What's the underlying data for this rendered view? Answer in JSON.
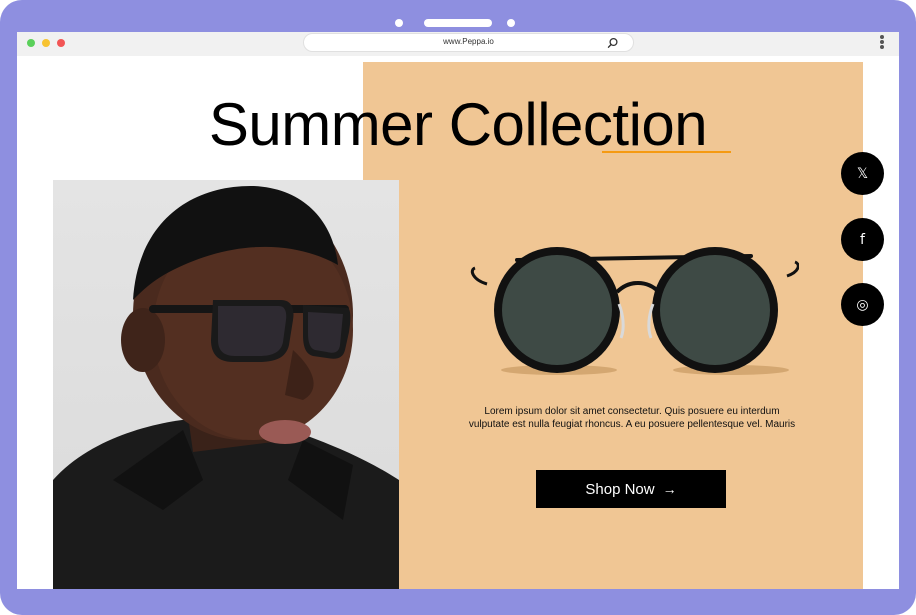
{
  "browser": {
    "url": "www.Peppa.io",
    "traffic_colors": [
      "#5ad05a",
      "#f7c331",
      "#f25555"
    ]
  },
  "hero": {
    "title": "Summer Collection",
    "accent_color": "#f59a12",
    "panel_color": "#f0c694"
  },
  "product": {
    "description_line1": "Lorem ipsum dolor sit amet consectetur. Quis posuere eu interdum",
    "description_line2": "vulputate est nulla feugiat rhoncus. A eu posuere pellentesque vel. Mauris",
    "cta_label": "Shop Now",
    "cta_arrow": "→"
  },
  "social": [
    {
      "name": "x-twitter-icon",
      "glyph": "𝕏"
    },
    {
      "name": "facebook-icon",
      "glyph": "f"
    },
    {
      "name": "instagram-icon",
      "glyph": "◎"
    }
  ],
  "icons": {
    "frame_color": "#8e8fe0",
    "search": "search-icon",
    "menu": "kebab-menu-icon"
  }
}
